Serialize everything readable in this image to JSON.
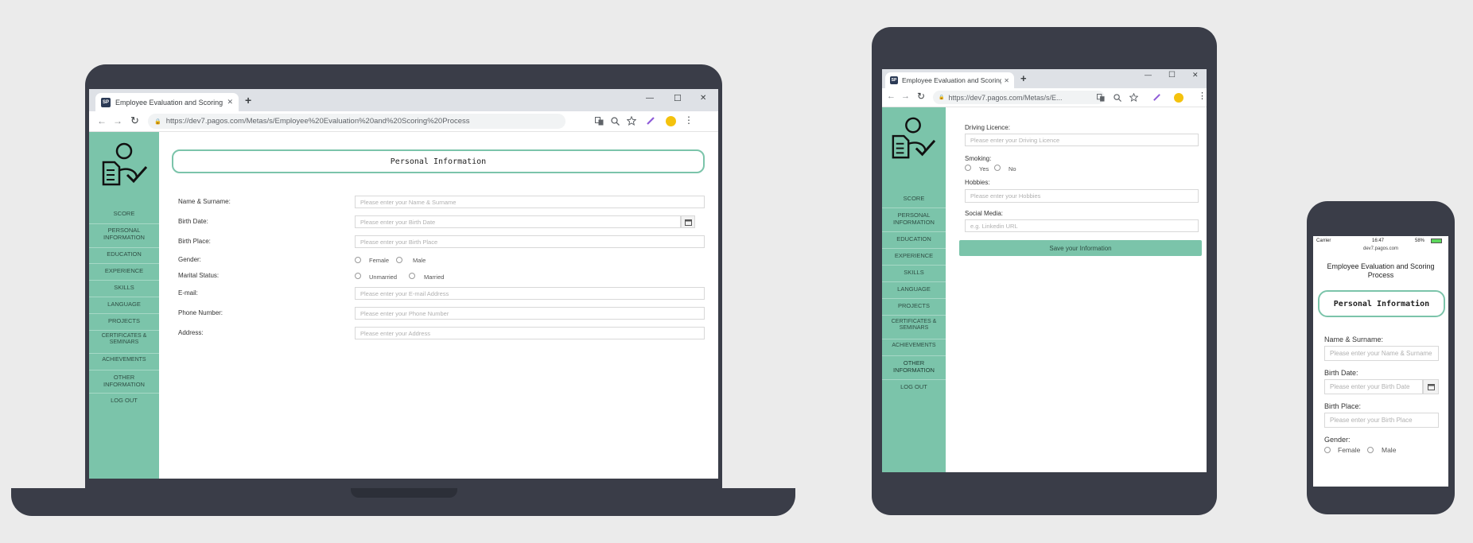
{
  "browser": {
    "tab_title": "Employee Evaluation and Scoring Process",
    "favicon_text": "SP",
    "new_tab": "+",
    "url_laptop": "https://dev7.pagos.com/Metas/s/Employee%20Evaluation%20and%20Scoring%20Process",
    "url_tablet": "https://dev7.pagos.com/Metas/s/E...",
    "window_controls": {
      "minimize": "—",
      "maximize": "☐",
      "close": "✕"
    },
    "nav": {
      "back": "←",
      "forward": "→",
      "reload": "↻",
      "lock": "🔒"
    },
    "icons": {
      "translate": "translate-icon",
      "zoom": "zoom-icon",
      "star": "star-icon",
      "pen": "pen-icon",
      "menu": "menu-icon"
    },
    "menu_dots": "⋮"
  },
  "sidebar": {
    "logo": "employee-check-icon",
    "items": [
      {
        "label": "SCORE"
      },
      {
        "label": "PERSONAL INFORMATION"
      },
      {
        "label": "EDUCATION"
      },
      {
        "label": "EXPERIENCE"
      },
      {
        "label": "SKILLS"
      },
      {
        "label": "LANGUAGE"
      },
      {
        "label": "PROJECTS"
      },
      {
        "label": "CERTIFICATES & SEMINARS"
      },
      {
        "label": "ACHIEVEMENTS"
      },
      {
        "label": "OTHER INFORMATION"
      },
      {
        "label": "LOG OUT"
      }
    ]
  },
  "personal": {
    "section_title": "Personal Information",
    "fields": {
      "name": {
        "label": "Name & Surname:",
        "placeholder": "Please enter your Name & Surname"
      },
      "birth_date": {
        "label": "Birth Date:",
        "placeholder": "Please enter your Birth Date"
      },
      "birth_place": {
        "label": "Birth Place:",
        "placeholder": "Please enter your Birth Place"
      },
      "gender": {
        "label": "Gender:",
        "options": [
          "Female",
          "Male"
        ]
      },
      "marital": {
        "label": "Marital Status:",
        "options": [
          "Unmarried",
          "Married"
        ]
      },
      "email": {
        "label": "E-mail:",
        "placeholder": "Please enter your E-mail Address"
      },
      "phone": {
        "label": "Phone Number:",
        "placeholder": "Please enter your Phone Number"
      },
      "address": {
        "label": "Address:",
        "placeholder": "Please enter your Address"
      }
    }
  },
  "other": {
    "driving": {
      "label": "Driving Licence:",
      "placeholder": "Please enter your Driving Licence"
    },
    "smoking": {
      "label": "Smoking:",
      "options": [
        "Yes",
        "No"
      ]
    },
    "hobbies": {
      "label": "Hobbies:",
      "placeholder": "Please enter your Hobbies"
    },
    "social": {
      "label": "Social Media:",
      "placeholder": "e.g. Linkedin URL"
    },
    "save_label": "Save your Information"
  },
  "phone": {
    "status_left": "Carrier",
    "status_time": "16:47",
    "status_right": "58%",
    "url": "dev7.pagos.com",
    "app_title": "Employee Evaluation and Scoring Process",
    "name_placeholder": "Please enter your Name & Surname",
    "birth_date_placeholder": "Please enter your Birth Date",
    "birth_place_placeholder": "Please enter your Birth Place"
  }
}
